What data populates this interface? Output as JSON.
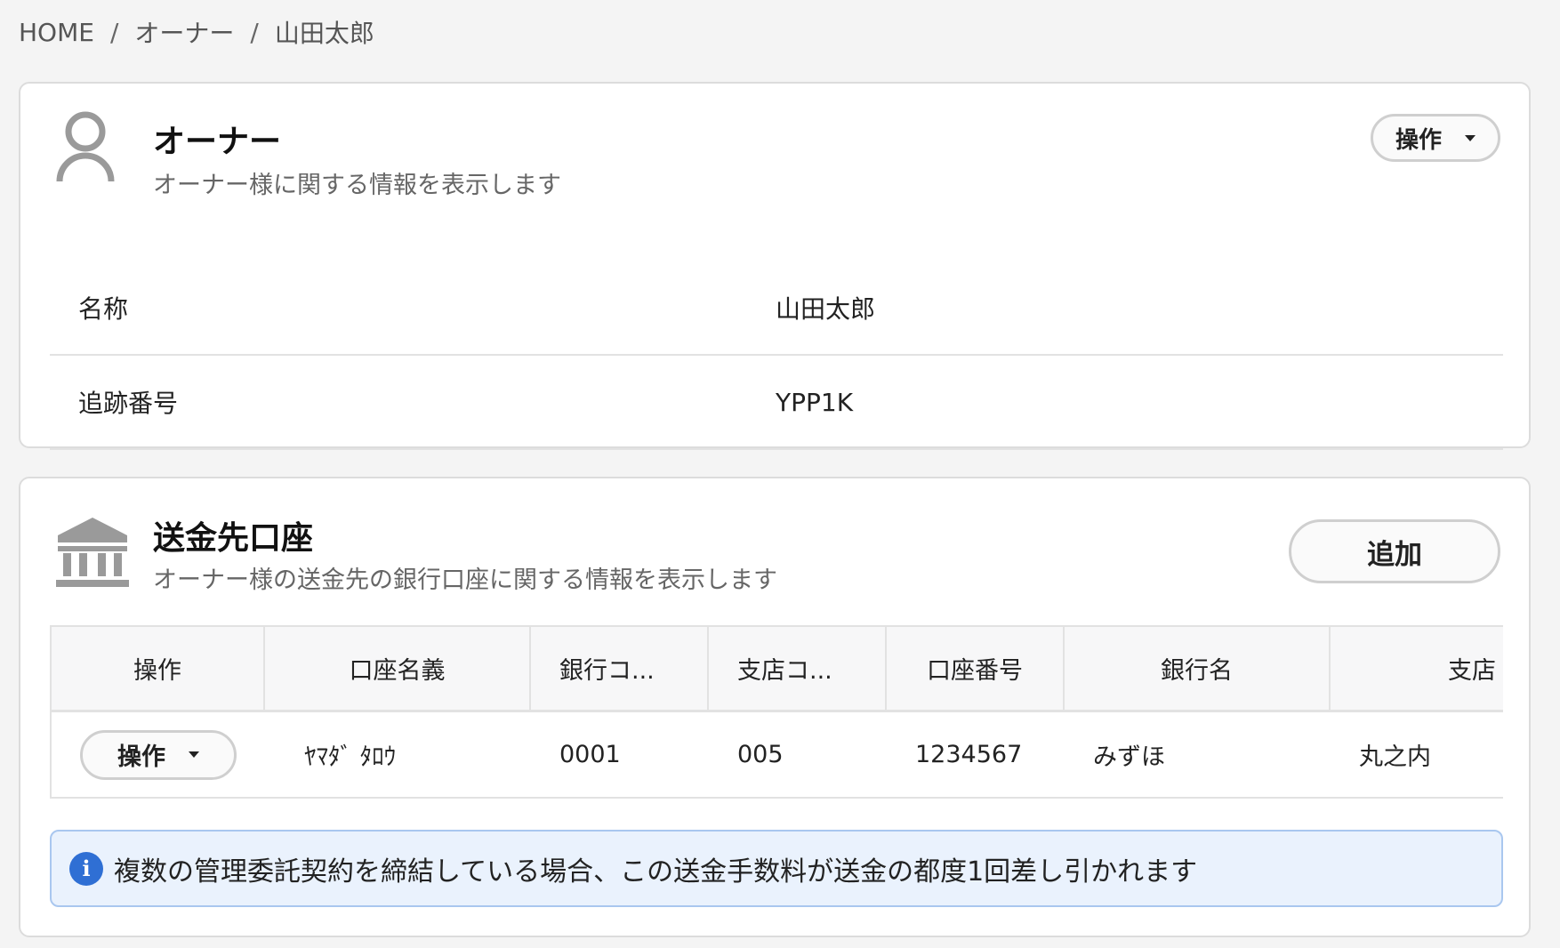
{
  "breadcrumb": {
    "items": [
      "HOME",
      "オーナー",
      "山田太郎"
    ],
    "separator": "/"
  },
  "owner_card": {
    "icon": "user-icon",
    "title": "オーナー",
    "subtitle": "オーナー様に関する情報を表示します",
    "action_label": "操作",
    "rows": [
      {
        "label": "名称",
        "value": "山田太郎"
      },
      {
        "label": "追跡番号",
        "value": "YPP1K"
      }
    ]
  },
  "account_card": {
    "icon": "bank-icon",
    "title": "送金先口座",
    "subtitle": "オーナー様の送金先の銀行口座に関する情報を表示します",
    "add_label": "追加",
    "table": {
      "columns": [
        "操作",
        "口座名義",
        "銀行コ...",
        "支店コ...",
        "口座番号",
        "銀行名",
        "支店"
      ],
      "rows": [
        {
          "action_label": "操作",
          "holder": "ﾔﾏﾀﾞ ﾀﾛｳ",
          "bank_code": "0001",
          "branch_code": "005",
          "account_number": "1234567",
          "bank_name": "みずほ",
          "branch_name": "丸之内"
        }
      ]
    },
    "notice": {
      "icon": "info-icon",
      "text": "複数の管理委託契約を締結している場合、この送金手数料が送金の都度1回差し引かれます"
    }
  },
  "colors": {
    "background": "#f4f4f4",
    "card_border": "#dcdcdc",
    "notice_bg": "#eaf2fd",
    "notice_border": "#a9c7ef",
    "info_icon": "#2f6fd4"
  }
}
